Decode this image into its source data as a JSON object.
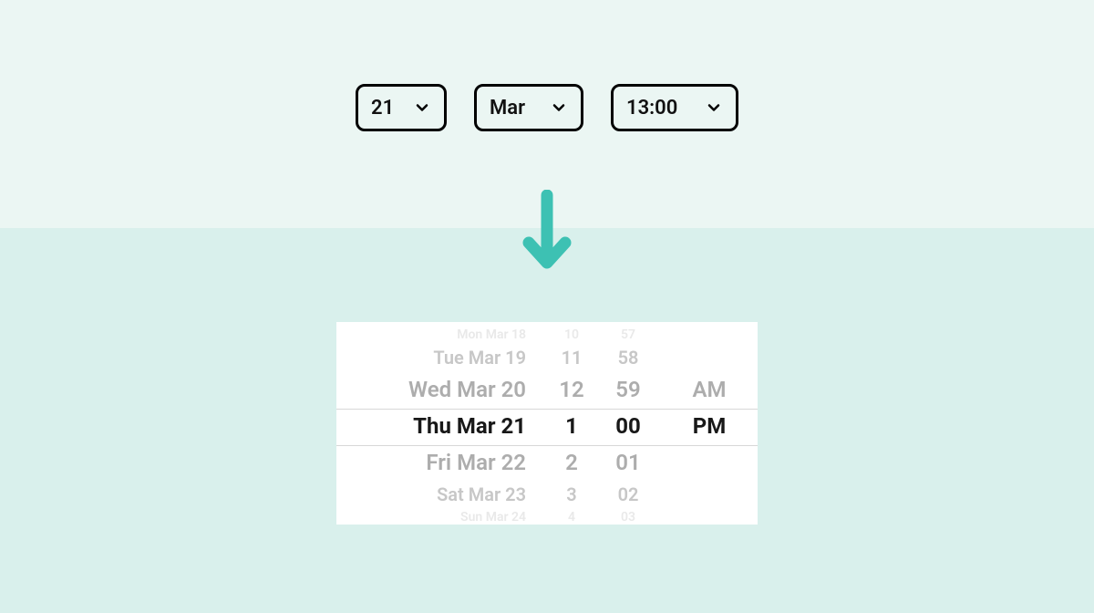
{
  "dropdowns": {
    "day": "21",
    "month": "Mar",
    "time": "13:00"
  },
  "picker": {
    "dates": {
      "r0": "Mon Mar 18",
      "r1": "Tue Mar 19",
      "r2": "Wed Mar 20",
      "r3": "Thu Mar 21",
      "r4": "Fri Mar 22",
      "r5": "Sat Mar 23",
      "r6": "Sun Mar 24"
    },
    "hours": {
      "r0": "10",
      "r1": "11",
      "r2": "12",
      "r3": "1",
      "r4": "2",
      "r5": "3",
      "r6": "4"
    },
    "minutes": {
      "r0": "57",
      "r1": "58",
      "r2": "59",
      "r3": "00",
      "r4": "01",
      "r5": "02",
      "r6": "03"
    },
    "ampm": {
      "r2": "AM",
      "r3": "PM"
    }
  }
}
